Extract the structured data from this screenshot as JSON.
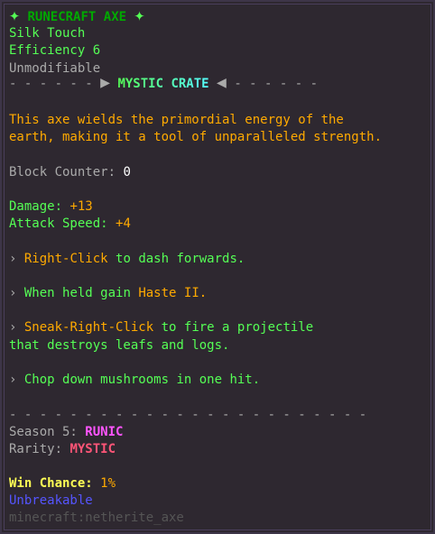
{
  "item": {
    "title": "RUNECRAFT AXE",
    "star_left": "✦",
    "star_right": "✦"
  },
  "enchants": [
    "Silk Touch",
    "Efficiency 6"
  ],
  "unmodifiable": "Unmodifiable",
  "crate": {
    "dashes_left": "- - - - - -",
    "arrow_left": "▶",
    "name": "MYSTIC CRATE",
    "arrow_right": "◀",
    "dashes_right": "- - - - - -"
  },
  "description": [
    "This axe wields the primordial energy of the",
    "earth, making it a tool of unparalleled strength."
  ],
  "block_counter": {
    "label": "Block Counter:",
    "value": "0"
  },
  "stats": {
    "damage_label": "Damage:",
    "damage_value": "+13",
    "speed_label": "Attack Speed:",
    "speed_value": "+4"
  },
  "abilities": {
    "chevron": "›",
    "a1_action": "Right-Click",
    "a1_rest": "to dash forwards.",
    "a2_prefix": "When held gain",
    "a2_effect": "Haste II.",
    "a3_action": "Sneak-Right-Click",
    "a3_rest": "to fire a projectile",
    "a3_line2": "that destroys leafs and logs.",
    "a4_text": "Chop down mushrooms in one hit."
  },
  "divider": "- - - - - - - - - - - - - - - - - - - - - - - -",
  "season": {
    "label": "Season 5:",
    "value": "RUNIC"
  },
  "rarity": {
    "label": "Rarity:",
    "value": "MYSTIC"
  },
  "win_chance": {
    "label": "Win Chance:",
    "value": "1%"
  },
  "unbreakable": "Unbreakable",
  "item_id": "minecraft:netherite_axe"
}
